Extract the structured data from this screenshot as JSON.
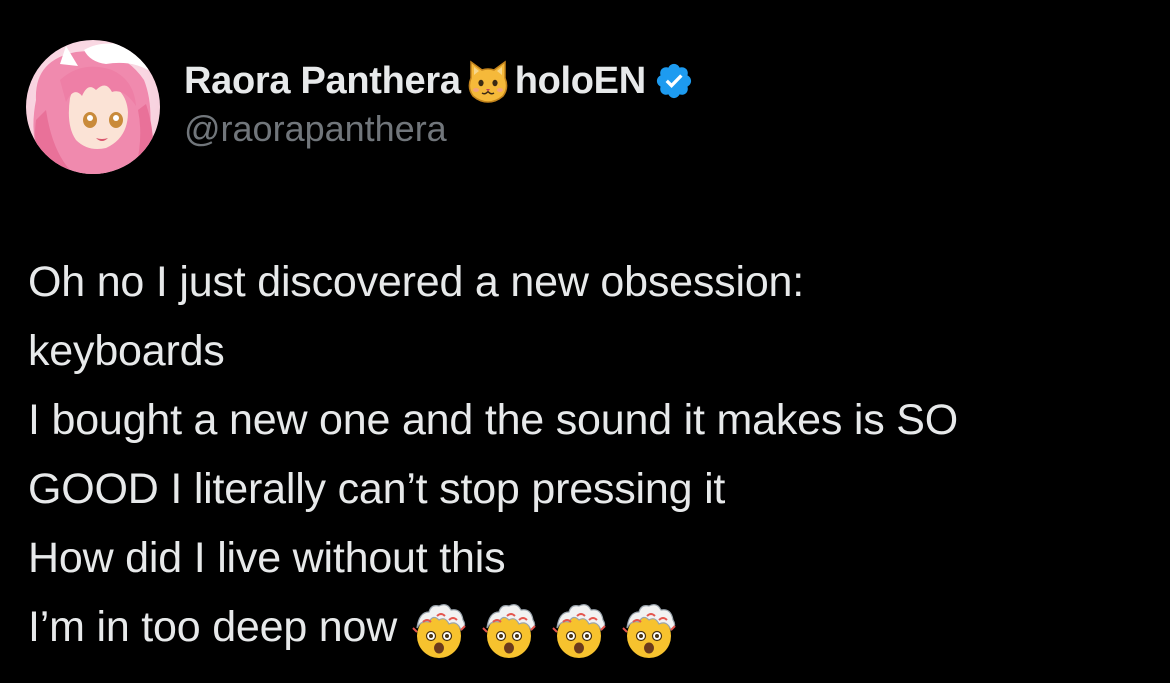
{
  "tweet": {
    "author": {
      "display_name": "Raora Panthera",
      "name_icon": "cat-face-icon",
      "name_suffix": "holoEN",
      "verified_icon": "verified-badge-icon",
      "handle": "@raorapanthera"
    },
    "lines": [
      "Oh no I just discovered a new obsession:",
      "keyboards",
      "I bought a new one and the sound it makes is SO",
      "GOOD I literally can’t stop pressing it",
      "How did I live without this",
      "I’m in too deep now"
    ],
    "trailing_emoji": [
      "exploding-head-emoji",
      "exploding-head-emoji",
      "exploding-head-emoji",
      "exploding-head-emoji"
    ]
  },
  "colors": {
    "background": "#000000",
    "text_primary": "#e7e9ea",
    "text_secondary": "#71767b",
    "verified_blue": "#1d9bf0",
    "avatar_hair_pink": "#f28bb0"
  }
}
